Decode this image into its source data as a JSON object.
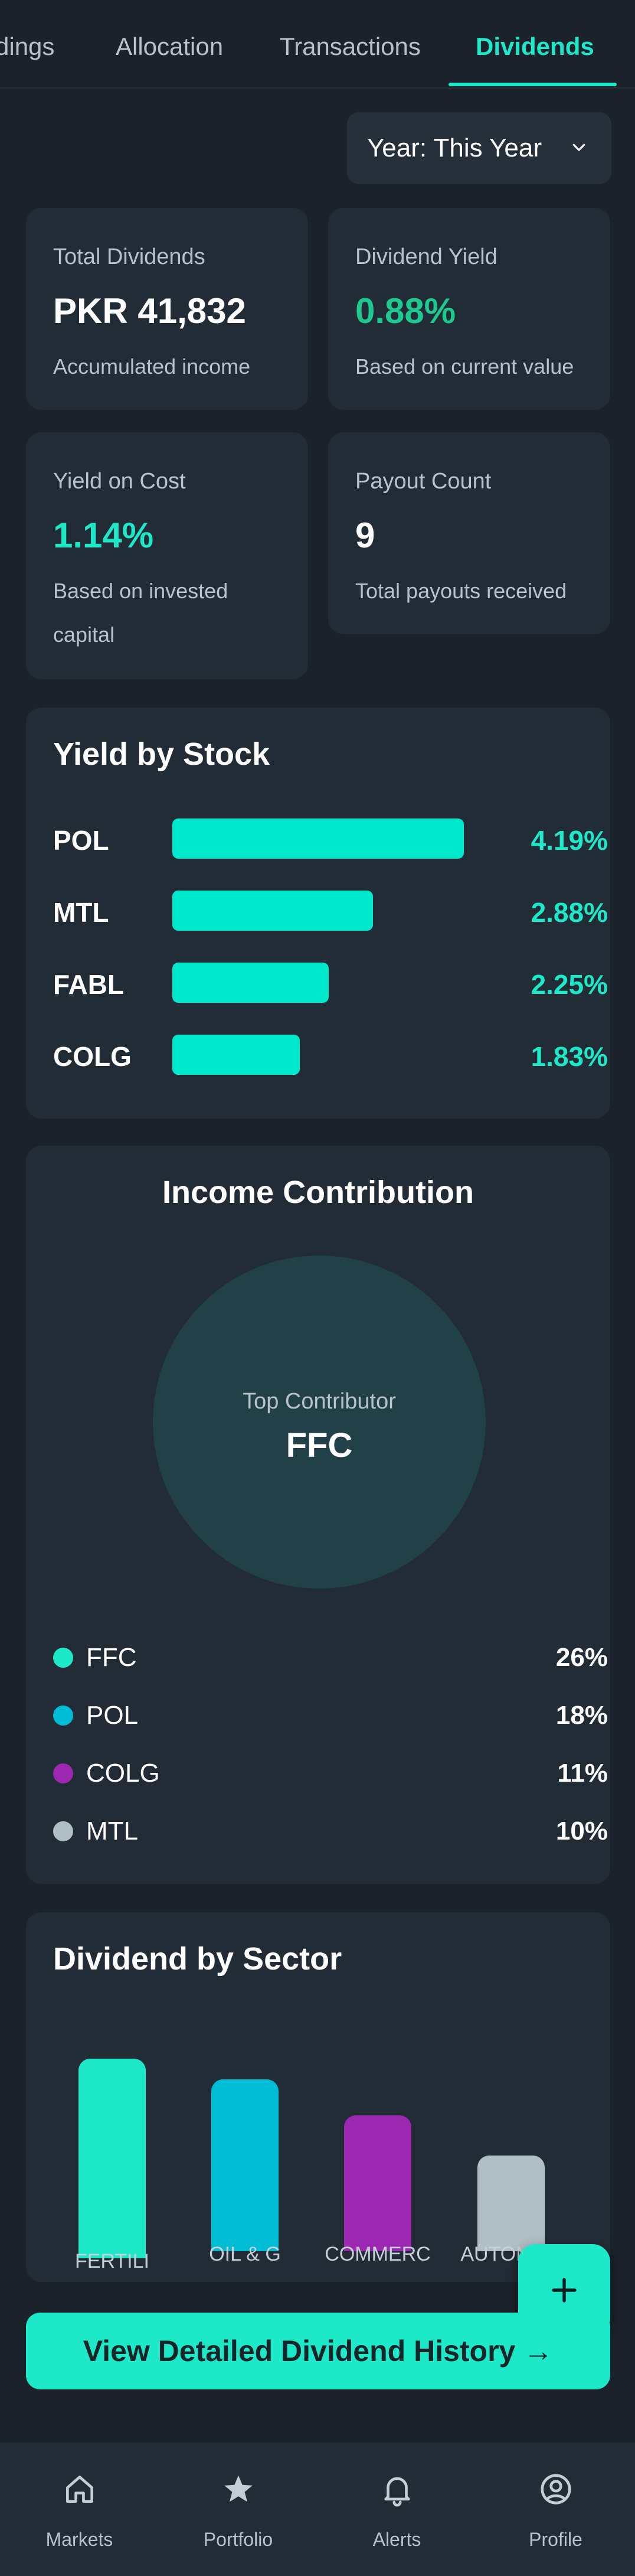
{
  "tabs": [
    {
      "label": "dings"
    },
    {
      "label": "Allocation"
    },
    {
      "label": "Transactions"
    },
    {
      "label": "Dividends"
    }
  ],
  "year_select": {
    "label": "Year: This Year"
  },
  "stats": {
    "total_dividends": {
      "label": "Total Dividends",
      "value": "PKR 41,832",
      "sub": "Accumulated income"
    },
    "dividend_yield": {
      "label": "Dividend Yield",
      "value": "0.88%",
      "sub": "Based on current value"
    },
    "yield_on_cost": {
      "label": "Yield on Cost",
      "value": "1.14%",
      "sub": "Based on invested capital"
    },
    "payout_count": {
      "label": "Payout Count",
      "value": "9",
      "sub": "Total payouts received"
    }
  },
  "yield_by_stock": {
    "title": "Yield by Stock",
    "items": [
      {
        "label": "POL",
        "value": "4.19%",
        "level": 4.19
      },
      {
        "label": "MTL",
        "value": "2.88%",
        "level": 2.88
      },
      {
        "label": "FABL",
        "value": "2.25%",
        "level": 2.25
      },
      {
        "label": "COLG",
        "value": "1.83%",
        "level": 1.83
      }
    ]
  },
  "income_contribution": {
    "title": "Income Contribution",
    "center_label": "Top Contributor",
    "center_value": "FFC",
    "legend": [
      {
        "label": "FFC",
        "value": "26%",
        "color": "#1de9c9"
      },
      {
        "label": "POL",
        "value": "18%",
        "color": "#00bcd4"
      },
      {
        "label": "COLG",
        "value": "11%",
        "color": "#9c27b0"
      },
      {
        "label": "MTL",
        "value": "10%",
        "color": "#b0bec5"
      }
    ]
  },
  "dividend_by_sector": {
    "title": "Dividend by Sector",
    "sectors": [
      {
        "label": "FERTILI",
        "level": 1.0,
        "color": "#1de9c9"
      },
      {
        "label": "OIL & G",
        "level": 0.86,
        "color": "#00bcd4"
      },
      {
        "label": "COMMERC",
        "level": 0.68,
        "color": "#9c27b0"
      },
      {
        "label": "AUTOMOB",
        "level": 0.48,
        "color": "#b0bec5"
      }
    ]
  },
  "fab": {
    "icon": "plus-icon",
    "label": "+"
  },
  "cta": {
    "label": "View Detailed Dividend History →"
  },
  "bottom_nav": [
    {
      "label": "Markets",
      "icon": "home-icon"
    },
    {
      "label": "Portfolio",
      "icon": "star-icon"
    },
    {
      "label": "Alerts",
      "icon": "bell-icon"
    },
    {
      "label": "Profile",
      "icon": "user-circle-icon"
    }
  ]
}
